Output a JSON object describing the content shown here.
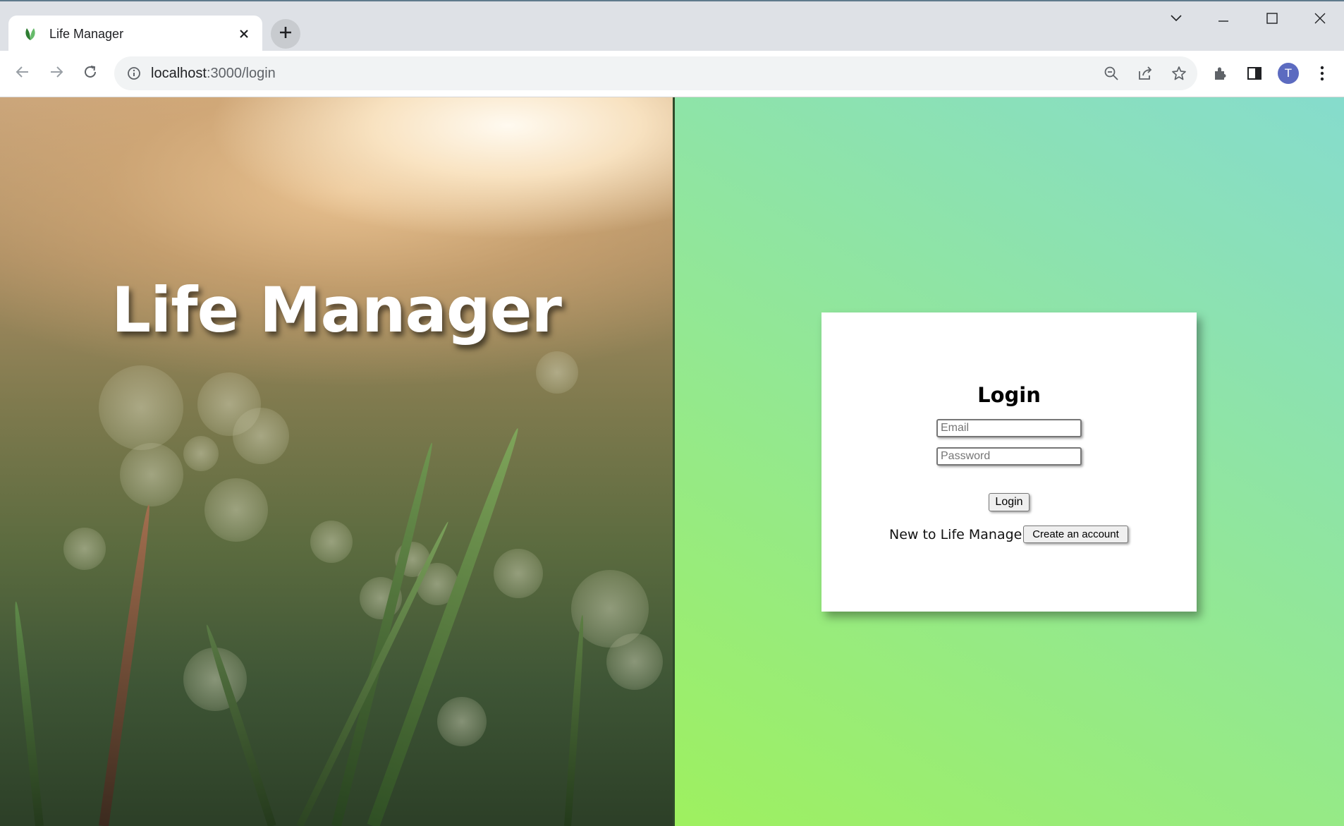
{
  "browser": {
    "tab_title": "Life Manager",
    "url_host": "localhost",
    "url_path": ":3000/login",
    "avatar_letter": "T",
    "icons": [
      "leaf-favicon-icon",
      "close-icon",
      "plus-icon",
      "chevron-down-icon",
      "minimize-icon",
      "maximize-icon",
      "close-window-icon",
      "back-arrow-icon",
      "forward-arrow-icon",
      "reload-icon",
      "info-icon",
      "zoom-out-icon",
      "share-icon",
      "star-icon",
      "extensions-icon",
      "side-panel-icon",
      "kebab-menu-icon"
    ]
  },
  "hero": {
    "title": "Life Manager"
  },
  "login": {
    "heading": "Login",
    "email_placeholder": "Email",
    "password_placeholder": "Password",
    "submit_label": "Login",
    "signup_prompt": "New to Life Manager?",
    "signup_button": "Create an account"
  },
  "colors": {
    "gradient_start": "#9ef05f",
    "gradient_end": "#86dccd",
    "card_bg": "#ffffff"
  }
}
